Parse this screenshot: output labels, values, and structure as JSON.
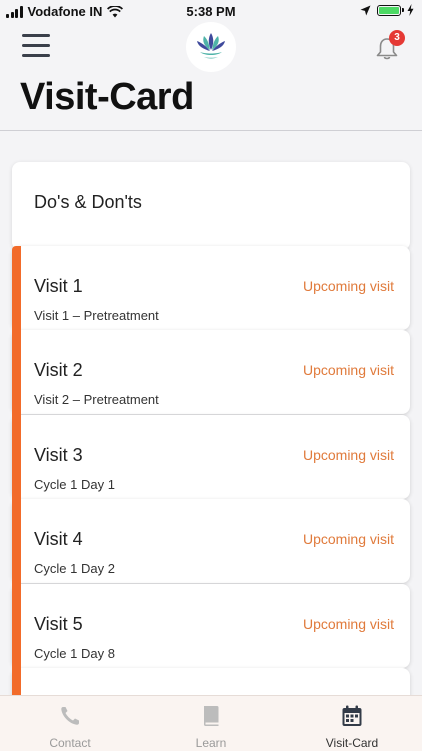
{
  "status_bar": {
    "carrier": "Vodafone IN",
    "time": "5:38 PM"
  },
  "header": {
    "title": "Visit-Card",
    "notification_count": "3",
    "menu_icon": "hamburger-menu-icon",
    "logo": "lotus-logo",
    "bell_icon": "bell-icon"
  },
  "dos_donts": {
    "label": "Do's & Don'ts"
  },
  "visits": [
    {
      "title": "Visit 1",
      "status": "Upcoming visit",
      "subtitle": "Visit 1 – Pretreatment"
    },
    {
      "title": "Visit 2",
      "status": "Upcoming visit",
      "subtitle": "Visit 2 – Pretreatment"
    },
    {
      "title": "Visit 3",
      "status": "Upcoming visit",
      "subtitle": "Cycle 1 Day 1"
    },
    {
      "title": "Visit 4",
      "status": "Upcoming visit",
      "subtitle": "Cycle 1 Day 2"
    },
    {
      "title": "Visit 5",
      "status": "Upcoming visit",
      "subtitle": "Cycle 1 Day 8"
    }
  ],
  "tabs": [
    {
      "label": "Contact",
      "icon": "phone-icon",
      "active": false
    },
    {
      "label": "Learn",
      "icon": "book-icon",
      "active": false
    },
    {
      "label": "Visit-Card",
      "icon": "calendar-icon",
      "active": true
    }
  ],
  "colors": {
    "accent": "#f26b2a",
    "status_text": "#e07a3b",
    "badge": "#e53935",
    "battery": "#4cd964"
  }
}
